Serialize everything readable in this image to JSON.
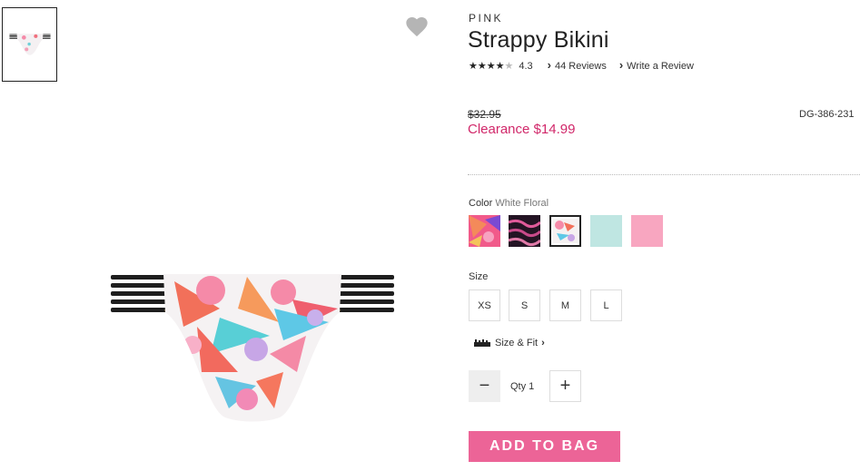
{
  "product": {
    "brand": "PINK",
    "title": "Strappy Bikini",
    "stars": "★★★★",
    "half_star": "★",
    "rating": "4.3",
    "reviews_link": "44 Reviews",
    "write_review_link": "Write a Review",
    "original_price": "$32.95",
    "sale_price": "Clearance $14.99",
    "sku": "DG-386-231"
  },
  "color": {
    "label": "Color",
    "selected": "White Floral",
    "swatches": [
      {
        "name": "pink-orange-floral",
        "color": "#f0649a"
      },
      {
        "name": "black-pink-tie-dye",
        "color": "#2d1a2e"
      },
      {
        "name": "white-floral",
        "color": "#f2eeee",
        "selected": true
      },
      {
        "name": "mint",
        "color": "#bfe6e2"
      },
      {
        "name": "light-pink",
        "color": "#f8a6c0"
      }
    ]
  },
  "size": {
    "label": "Size",
    "options": [
      "XS",
      "S",
      "M",
      "L"
    ],
    "fit_link": "Size & Fit"
  },
  "quantity": {
    "minus": "−",
    "label": "Qty 1",
    "plus": "+"
  },
  "actions": {
    "add_to_bag": "ADD TO BAG"
  },
  "icons": {
    "favorite": "heart-icon",
    "chevron": "chevron-right-icon",
    "ruler": "ruler-icon"
  },
  "colors": {
    "accent_pink": "#ec6497",
    "sale_text": "#d1286a",
    "heart": "#b5b5b5"
  }
}
